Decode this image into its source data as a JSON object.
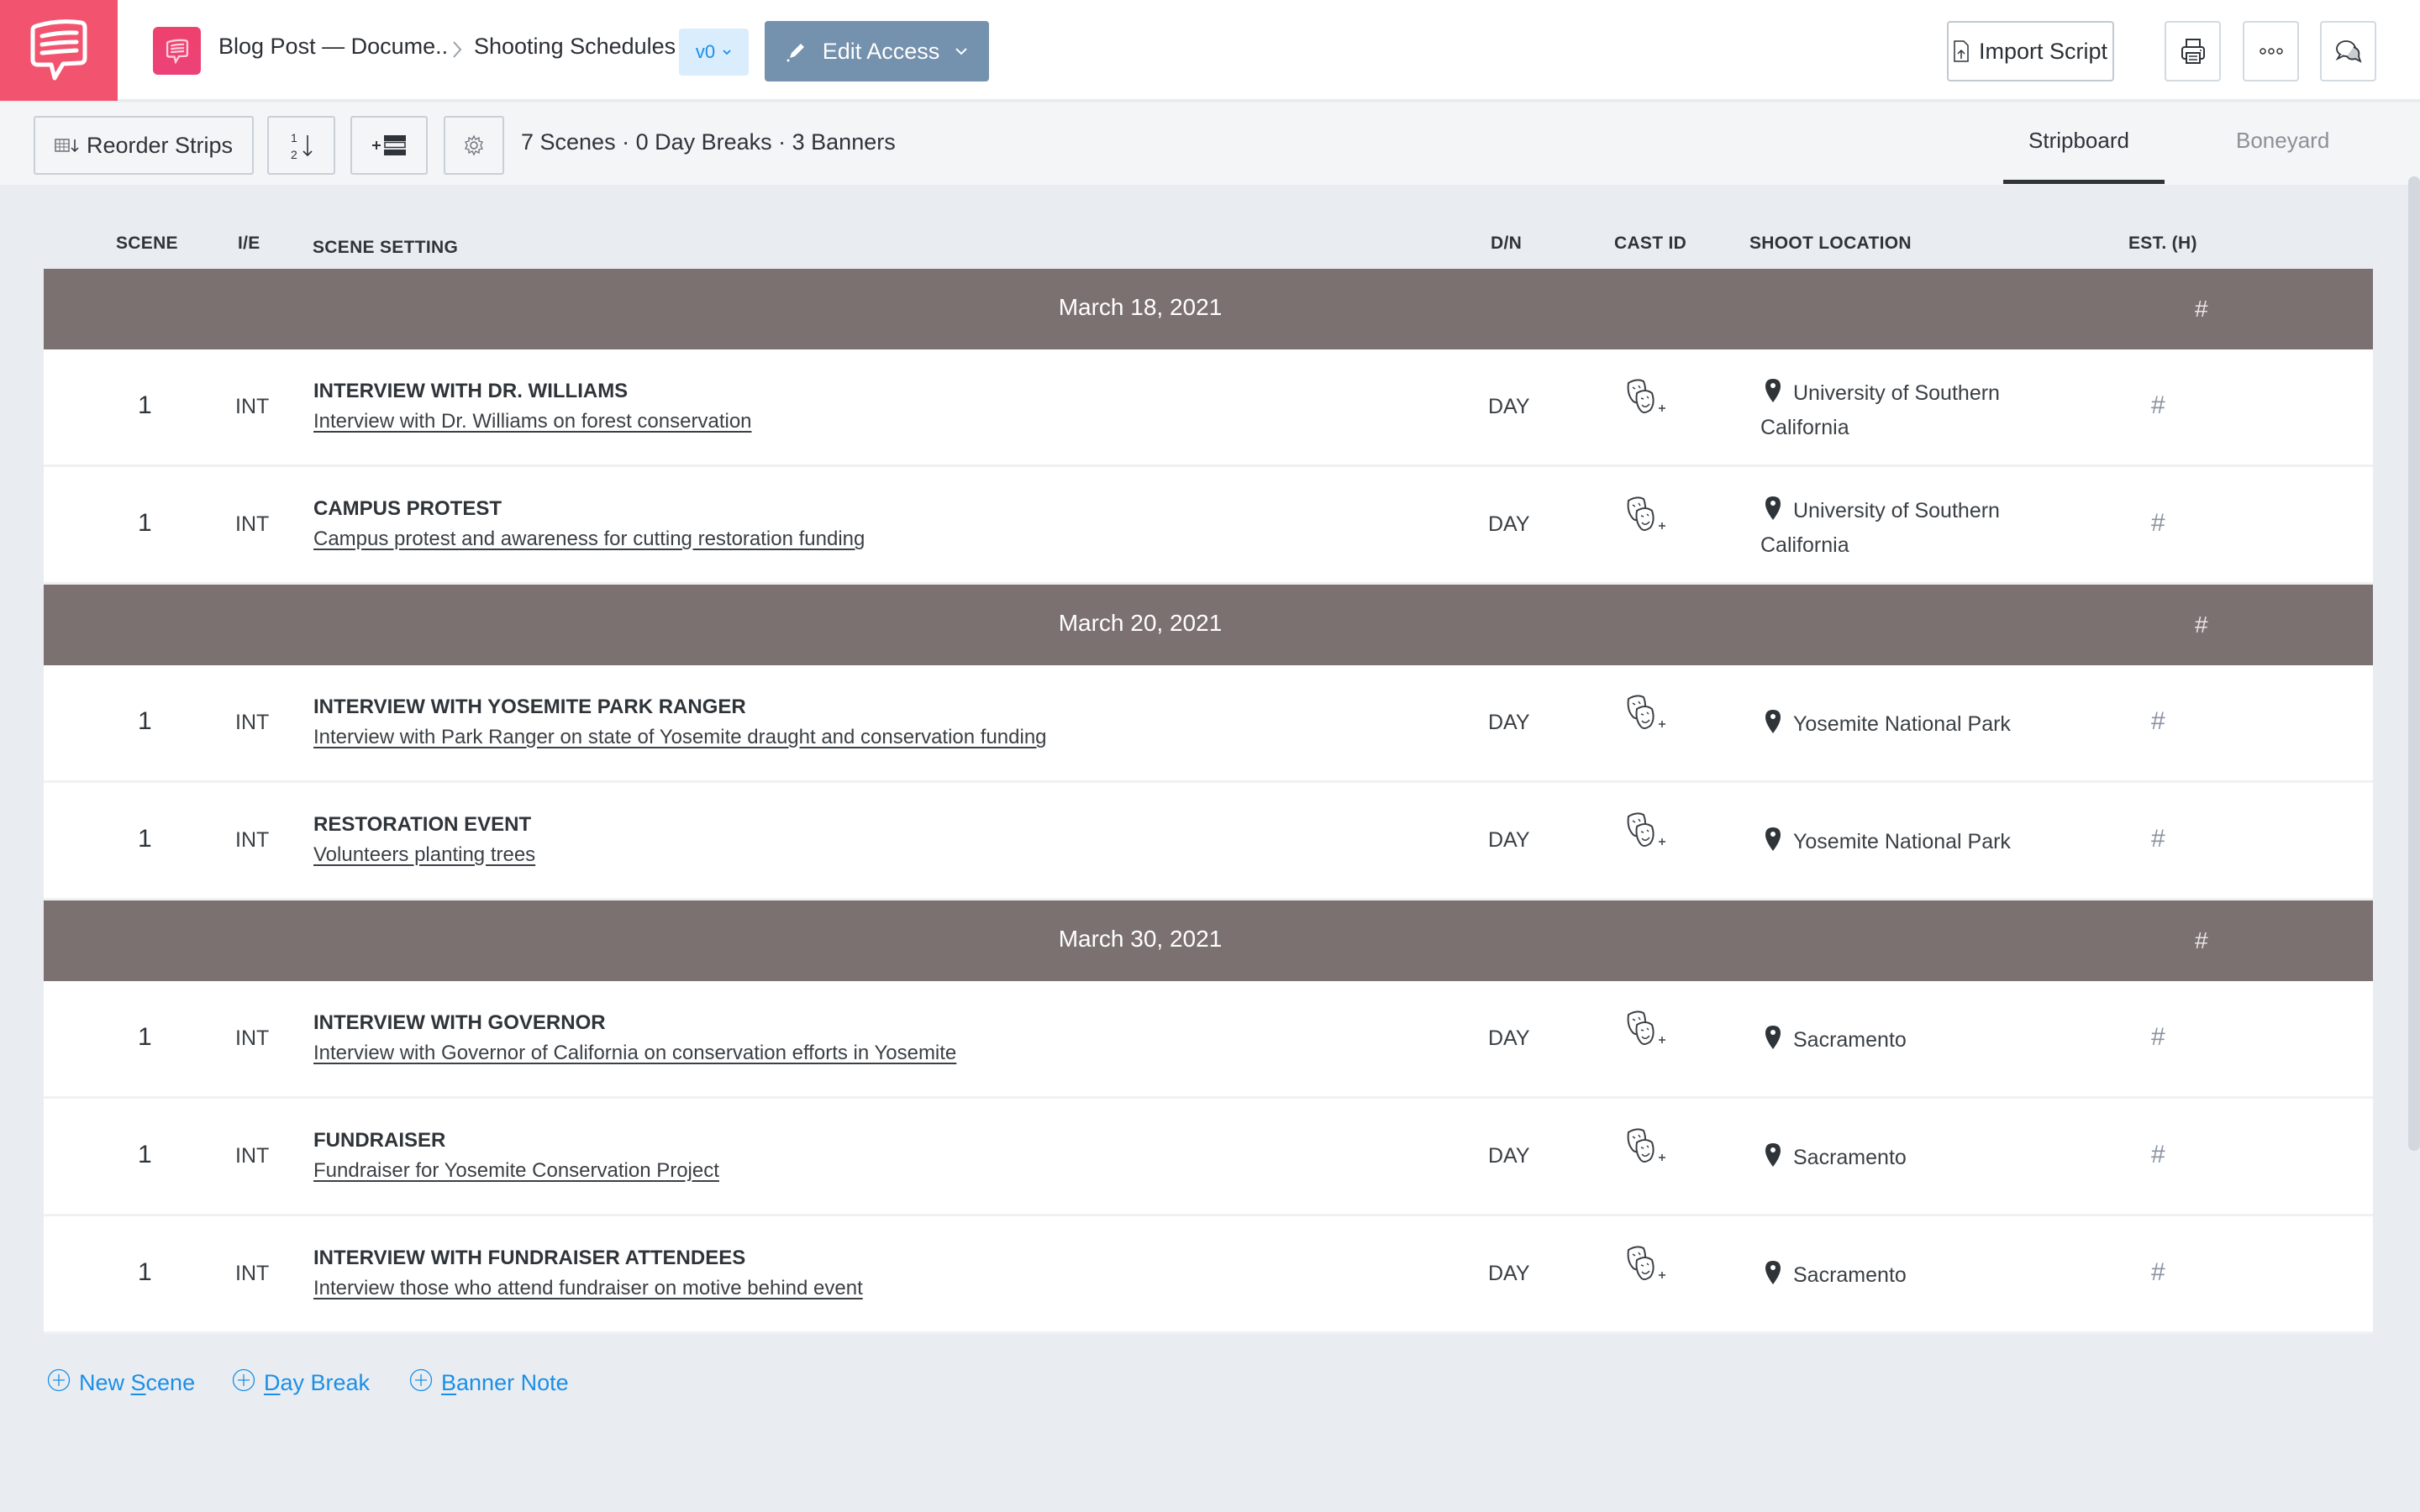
{
  "header": {
    "app_logo": "speech-bubble-logo",
    "breadcrumb": {
      "project": "Blog Post — Docume..",
      "page": "Shooting Schedules"
    },
    "version": "v0",
    "edit_access_label": "Edit Access",
    "import_script_label": "Import Script",
    "icons": {
      "print": "print-icon",
      "more": "more-icon",
      "comments": "comments-icon"
    }
  },
  "toolbar": {
    "reorder_label": "Reorder Strips",
    "summary": "7 Scenes · 0 Day Breaks · 3 Banners",
    "tabs": [
      {
        "label": "Stripboard",
        "active": true
      },
      {
        "label": "Boneyard",
        "active": false
      }
    ]
  },
  "columns": {
    "scene": "SCENE",
    "ie": "I/E",
    "setting": "SCENE SETTING",
    "dn": "D/N",
    "cast": "CAST ID",
    "location": "SHOOT LOCATION",
    "est": "EST. (H)"
  },
  "days": [
    {
      "date": "March 18, 2021",
      "est": "#",
      "scenes": [
        {
          "scene": "1",
          "ie": "INT",
          "title": "INTERVIEW WITH DR. WILLIAMS",
          "description": "Interview with Dr. Williams on forest conservation",
          "dn": "DAY",
          "location_line1": "University of Southern",
          "location_line2": "California",
          "est": "#"
        },
        {
          "scene": "1",
          "ie": "INT",
          "title": "CAMPUS PROTEST",
          "description": "Campus protest and awareness for cutting restoration funding",
          "dn": "DAY",
          "location_line1": "University of Southern",
          "location_line2": "California",
          "est": "#"
        }
      ]
    },
    {
      "date": "March 20, 2021",
      "est": "#",
      "scenes": [
        {
          "scene": "1",
          "ie": "INT",
          "title": "INTERVIEW WITH YOSEMITE PARK RANGER",
          "description": "Interview with Park Ranger on state of Yosemite draught and conservation funding",
          "dn": "DAY",
          "location_line1": "Yosemite National Park",
          "location_line2": "",
          "est": "#"
        },
        {
          "scene": "1",
          "ie": "INT",
          "title": "RESTORATION EVENT",
          "description": "Volunteers planting trees ",
          "dn": "DAY",
          "location_line1": "Yosemite National Park",
          "location_line2": "",
          "est": "#"
        }
      ]
    },
    {
      "date": "March 30, 2021",
      "est": "#",
      "scenes": [
        {
          "scene": "1",
          "ie": "INT",
          "title": "INTERVIEW WITH GOVERNOR",
          "description": "Interview with Governor of California on conservation efforts in Yosemite",
          "dn": "DAY",
          "location_line1": "Sacramento",
          "location_line2": "",
          "est": "#"
        },
        {
          "scene": "1",
          "ie": "INT",
          "title": "FUNDRAISER",
          "description": "Fundraiser for Yosemite Conservation Project",
          "dn": "DAY",
          "location_line1": "Sacramento",
          "location_line2": "",
          "est": "#"
        },
        {
          "scene": "1",
          "ie": "INT",
          "title": "INTERVIEW WITH FUNDRAISER ATTENDEES",
          "description": "Interview those who attend fundraiser on motive behind event",
          "dn": "DAY",
          "location_line1": "Sacramento",
          "location_line2": "",
          "est": "#"
        }
      ]
    }
  ],
  "footer_actions": [
    {
      "label_pre": "New ",
      "label_key": "S",
      "label_post": "cene"
    },
    {
      "label_pre": "",
      "label_key": "D",
      "label_post": "ay Break"
    },
    {
      "label_pre": "",
      "label_key": "B",
      "label_post": "anner Note"
    }
  ],
  "colors": {
    "brand": "#f2546f",
    "banner": "#7b7170",
    "edit_access": "#7491ad",
    "link": "#1a8fe8",
    "version_bg": "#daedfd"
  }
}
